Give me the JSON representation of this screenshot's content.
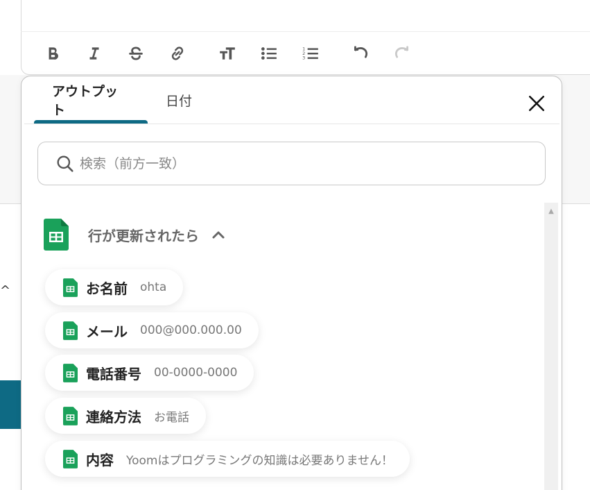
{
  "toolbar": {
    "buttons": [
      {
        "name": "bold-icon",
        "enabled": true
      },
      {
        "name": "italic-icon",
        "enabled": true
      },
      {
        "name": "strikethrough-icon",
        "enabled": true
      },
      {
        "name": "link-icon",
        "enabled": true
      },
      {
        "name": "text-size-icon",
        "enabled": true
      },
      {
        "name": "bullet-list-icon",
        "enabled": true
      },
      {
        "name": "numbered-list-icon",
        "enabled": true
      },
      {
        "name": "undo-icon",
        "enabled": true
      },
      {
        "name": "redo-icon",
        "enabled": false
      }
    ]
  },
  "modal": {
    "tabs": [
      {
        "label": "アウトプット",
        "active": true
      },
      {
        "label": "日付",
        "active": false
      }
    ],
    "search": {
      "placeholder": "検索（前方一致）",
      "value": ""
    },
    "section": {
      "title": "行が更新されたら",
      "icon": "google-sheets-icon",
      "expanded": true
    },
    "fields": [
      {
        "label": "お名前",
        "value": "ohta"
      },
      {
        "label": "メール",
        "value": "000@000.000.00"
      },
      {
        "label": "電話番号",
        "value": "00-0000-0000"
      },
      {
        "label": "連絡方法",
        "value": "お電話"
      },
      {
        "label": "内容",
        "value": "Yoomはプログラミングの知識は必要ありません！"
      }
    ]
  },
  "colors": {
    "accent": "#0e6a84",
    "sheets_green": "#1aa15a"
  }
}
